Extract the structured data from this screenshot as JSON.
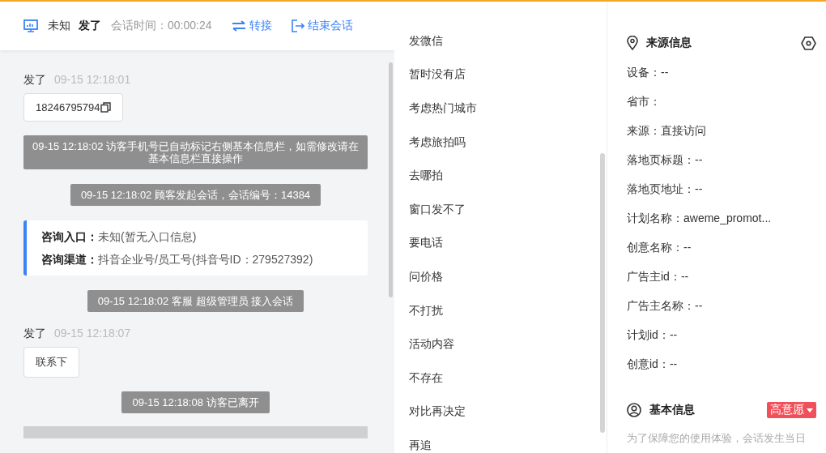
{
  "header": {
    "visitor_name": "未知",
    "nickname": "发了",
    "duration_label": "会话时间：",
    "duration": "00:00:24",
    "actions": [
      {
        "kind": "transfer",
        "label": "转接"
      },
      {
        "kind": "end",
        "label": "结束会话"
      }
    ]
  },
  "messages": [
    {
      "kind": "visitor",
      "sender": "发了",
      "time": "09-15 12:18:01",
      "text": "18246795794",
      "copyable": true
    },
    {
      "kind": "system",
      "text": "09-15 12:18:02 访客手机号已自动标记右侧基本信息栏，如需修改请在基本信息栏直接操作",
      "wide": true
    },
    {
      "kind": "system",
      "text": "09-15 12:18:02 顾客发起会话，会话编号：14384",
      "wide": false
    },
    {
      "kind": "info",
      "lines": [
        {
          "label": "咨询入口：",
          "value": "未知(暂无入口信息)"
        },
        {
          "label": "咨询渠道：",
          "value": "抖音企业号/员工号(抖音号ID：279527392)"
        }
      ]
    },
    {
      "kind": "system",
      "text": "09-15 12:18:02 客服 超级管理员 接入会话",
      "wide": false
    },
    {
      "kind": "visitor",
      "sender": "发了",
      "time": "09-15 12:18:07",
      "text": "联系下",
      "copyable": false
    },
    {
      "kind": "system",
      "text": "09-15 12:18:08 访客已离开",
      "wide": false
    }
  ],
  "quick_replies": [
    "发微信",
    "暂时没有店",
    "考虑热门城市",
    "考虑旅拍吗",
    "去哪拍",
    "窗口发不了",
    "要电话",
    "问价格",
    "不打扰",
    "活动内容",
    "不存在",
    "对比再决定",
    "再追"
  ],
  "source_info": {
    "title": "来源信息",
    "fields": [
      "设备：--",
      "省市：",
      "来源：直接访问",
      "落地页标题：--",
      "落地页地址：--",
      "计划名称：aweme_promot...",
      "创意名称：--",
      "广告主id：--",
      "广告主名称：--",
      "计划id：--",
      "创意id：--"
    ]
  },
  "basic_info": {
    "title": "基本信息",
    "intent_tag": "高意愿",
    "notice": "为了保障您的使用体验，会话发生当日"
  }
}
